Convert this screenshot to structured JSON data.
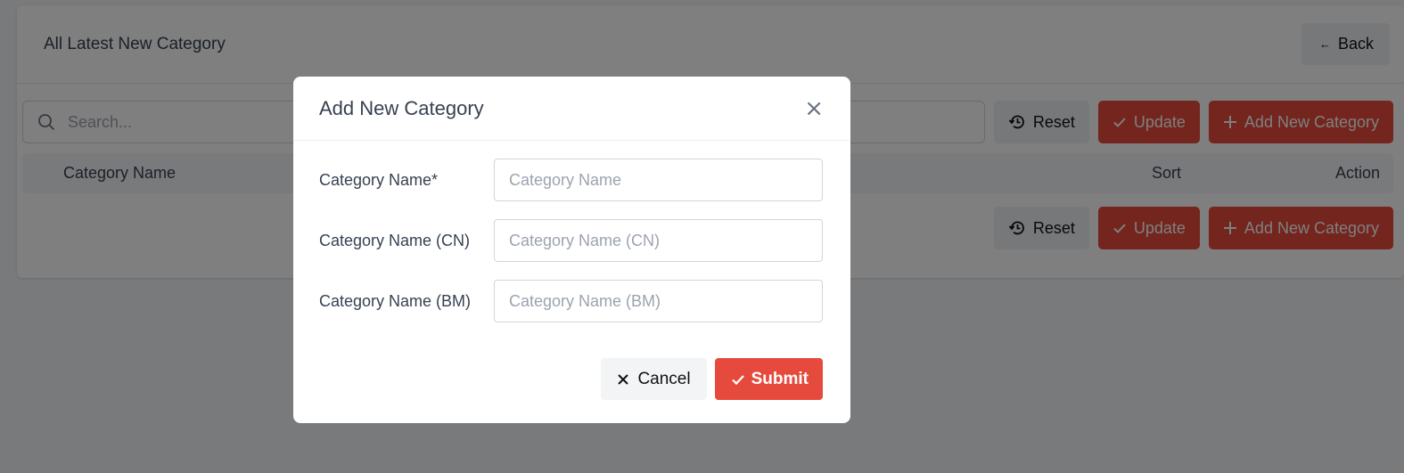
{
  "page": {
    "title": "All Latest New Category",
    "back_label": "Back",
    "search_placeholder": "Search...",
    "reset_label": "Reset",
    "update_label": "Update",
    "add_label": "Add New Category",
    "table": {
      "columns": [
        "Category Name",
        "Sort",
        "Action"
      ]
    }
  },
  "modal": {
    "title": "Add New Category",
    "fields": [
      {
        "label": "Category Name*",
        "placeholder": "Category Name",
        "value": ""
      },
      {
        "label": "Category Name (CN)",
        "placeholder": "Category Name (CN)",
        "value": ""
      },
      {
        "label": "Category Name (BM)",
        "placeholder": "Category Name (BM)",
        "value": ""
      }
    ],
    "cancel_label": "Cancel",
    "submit_label": "Submit"
  },
  "colors": {
    "primary_red": "#e64a3c",
    "overlay": "rgba(0,0,0,0.5)"
  }
}
